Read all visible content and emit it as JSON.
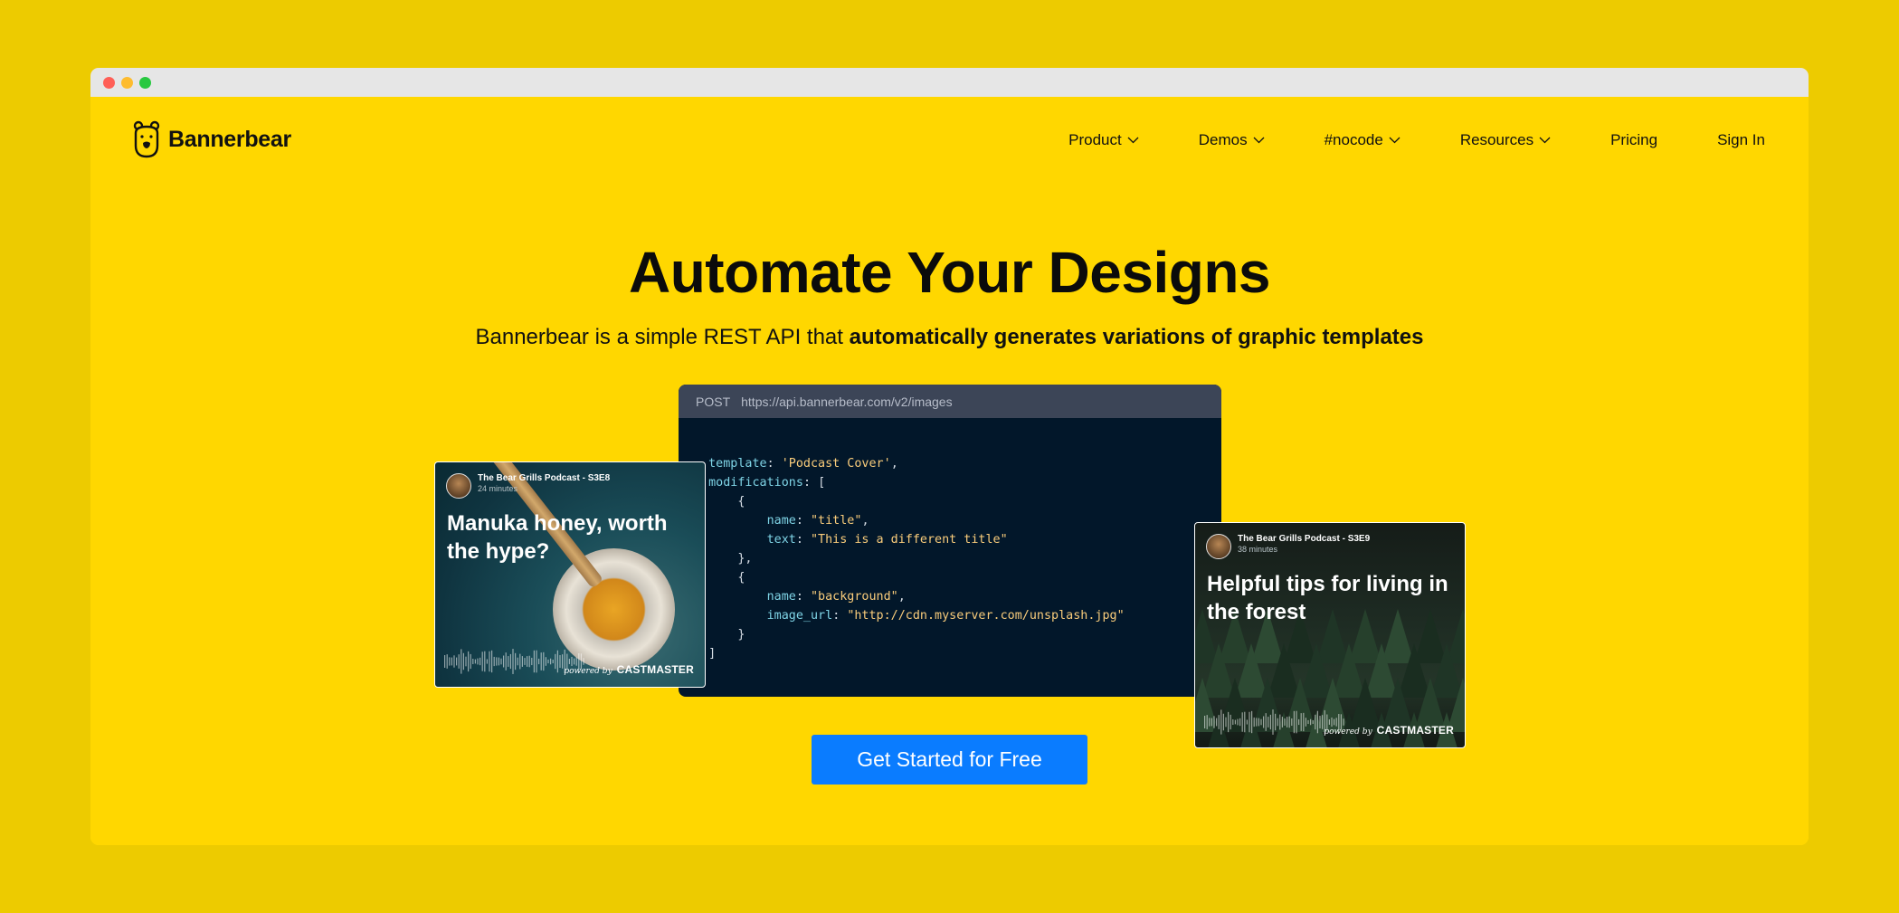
{
  "brand": {
    "name": "Bannerbear",
    "background_color": "#FFD700",
    "outer_color": "#EDCB00",
    "cta_color": "#0A7CFF"
  },
  "nav": {
    "items": [
      {
        "label": "Product",
        "has_dropdown": true
      },
      {
        "label": "Demos",
        "has_dropdown": true
      },
      {
        "label": "#nocode",
        "has_dropdown": true
      },
      {
        "label": "Resources",
        "has_dropdown": true
      },
      {
        "label": "Pricing",
        "has_dropdown": false
      },
      {
        "label": "Sign In",
        "has_dropdown": false
      }
    ]
  },
  "hero": {
    "title": "Automate Your Designs",
    "subtitle_plain": "Bannerbear is a simple REST API that ",
    "subtitle_bold": "automatically generates variations of graphic templates"
  },
  "code_panel": {
    "method": "POST",
    "url": "https://api.bannerbear.com/v2/images",
    "lines": [
      {
        "indent": "  ",
        "key": "template",
        "sep": ": ",
        "str": "'Podcast Cover'",
        "tail": ","
      },
      {
        "indent": "  ",
        "key": "modifications",
        "sep": ": ",
        "str": "",
        "tail": "["
      },
      {
        "indent": "      ",
        "key": "",
        "sep": "",
        "str": "",
        "tail": "{"
      },
      {
        "indent": "          ",
        "key": "name",
        "sep": ": ",
        "str": "\"title\"",
        "tail": ","
      },
      {
        "indent": "          ",
        "key": "text",
        "sep": ": ",
        "str": "\"This is a different title\"",
        "tail": ""
      },
      {
        "indent": "      ",
        "key": "",
        "sep": "",
        "str": "",
        "tail": "},"
      },
      {
        "indent": "      ",
        "key": "",
        "sep": "",
        "str": "",
        "tail": "{"
      },
      {
        "indent": "          ",
        "key": "name",
        "sep": ": ",
        "str": "\"background\"",
        "tail": ","
      },
      {
        "indent": "          ",
        "key": "image_url",
        "sep": ": ",
        "str": "\"http://cdn.myserver.com/unsplash.jpg\"",
        "tail": ""
      },
      {
        "indent": "      ",
        "key": "",
        "sep": "",
        "str": "",
        "tail": "}"
      },
      {
        "indent": "  ",
        "key": "",
        "sep": "",
        "str": "",
        "tail": "]"
      },
      {
        "indent": "",
        "key": "",
        "sep": "",
        "str": "",
        "tail": "}"
      }
    ]
  },
  "cards": [
    {
      "show": "The Bear Grills Podcast - S3E8",
      "duration": "24 minutes",
      "title": "Manuka honey, worth the hype?",
      "powered_pre": "powered by",
      "powered_brand": "CASTMASTER"
    },
    {
      "show": "The Bear Grills Podcast - S3E9",
      "duration": "38 minutes",
      "title": "Helpful tips for living in the forest",
      "powered_pre": "powered by",
      "powered_brand": "CASTMASTER"
    }
  ],
  "cta": {
    "label": "Get Started for Free"
  }
}
